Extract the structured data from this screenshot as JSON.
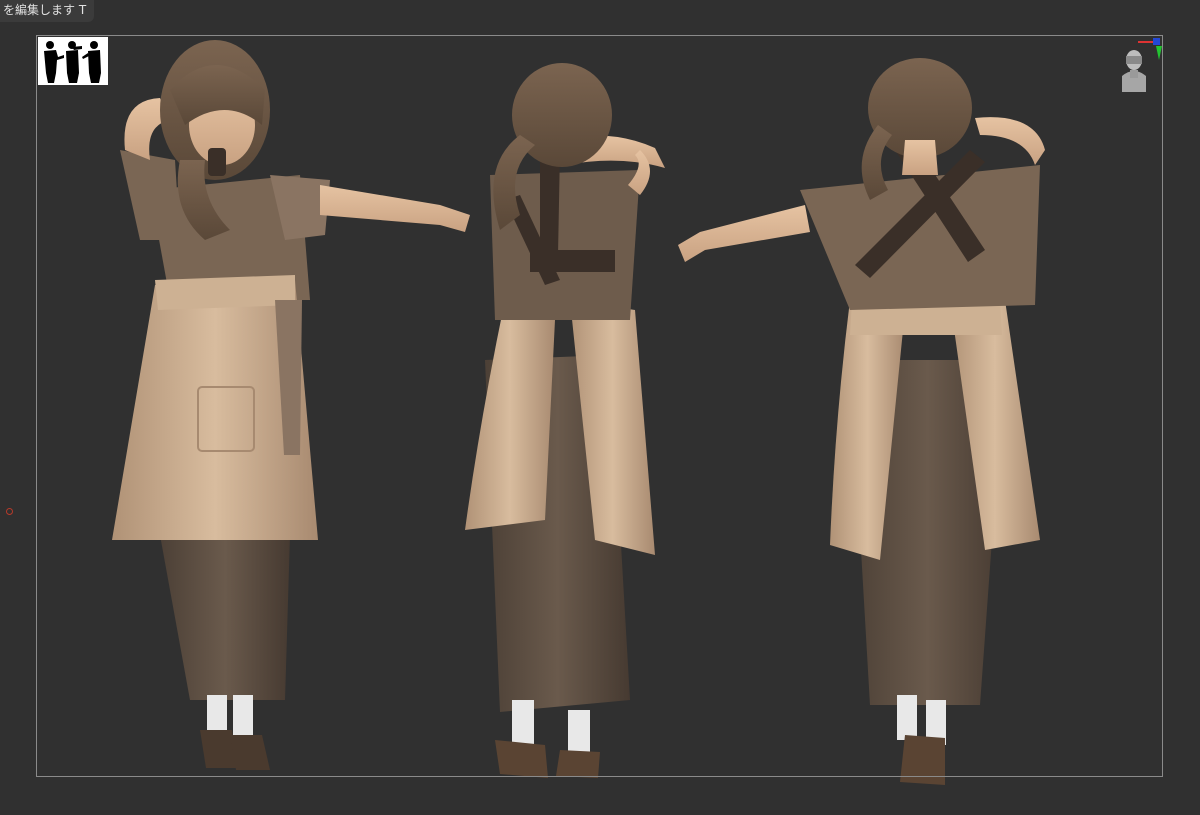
{
  "tooltip": {
    "text": "を編集します T"
  },
  "viewport": {
    "background_color": "#303030",
    "frame_color": "#8a8a8a",
    "model_color": "#c8a98c",
    "shadow_color": "#5a4a3c",
    "dress_color": "#5e5044"
  },
  "icons": {
    "thumbnail": "silhouette-thumbnail-icon",
    "gizmo": "head-orientation-gizmo-icon",
    "pivot": "pivot-point-icon"
  },
  "figures": [
    {
      "name": "front-view-figure"
    },
    {
      "name": "back-view-figure"
    },
    {
      "name": "rear-quarter-view-figure"
    }
  ]
}
